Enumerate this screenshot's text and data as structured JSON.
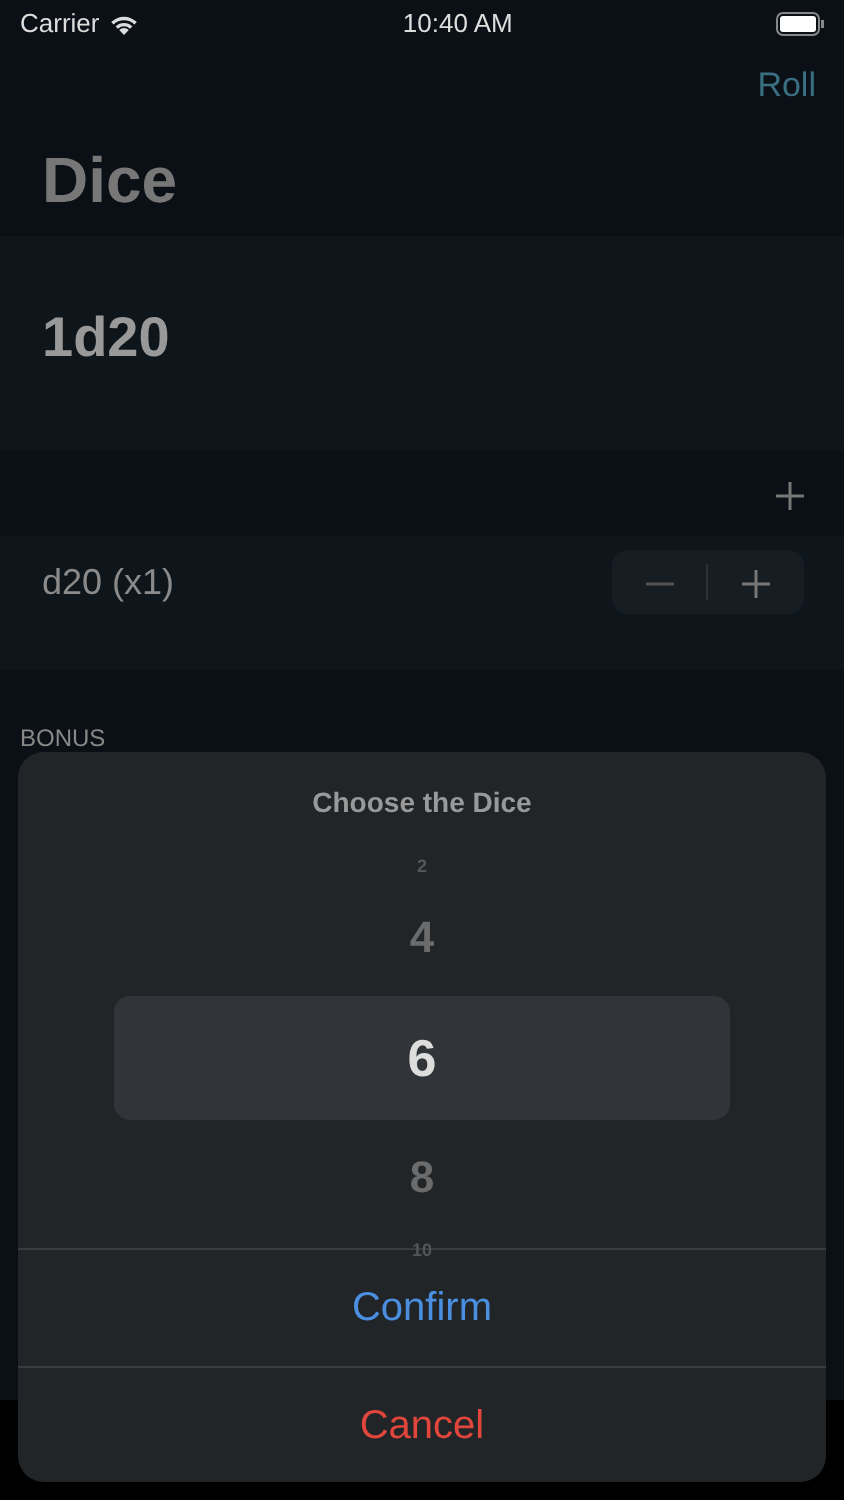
{
  "status_bar": {
    "carrier": "Carrier",
    "time": "10:40 AM"
  },
  "nav": {
    "action": "Roll",
    "title": "Dice"
  },
  "formula": "1d20",
  "dice": [
    {
      "label": "d20 (x1)"
    }
  ],
  "section_label": "BONUS",
  "sheet": {
    "title": "Choose the Dice",
    "picker": [
      {
        "label": "2",
        "selected": false,
        "kind": "edge"
      },
      {
        "label": "4",
        "selected": false,
        "kind": "near"
      },
      {
        "label": "6",
        "selected": true,
        "kind": "near"
      },
      {
        "label": "8",
        "selected": false,
        "kind": "near"
      },
      {
        "label": "10",
        "selected": false,
        "kind": "edge"
      }
    ],
    "actions": [
      {
        "label": "Confirm",
        "kind": "default"
      },
      {
        "label": "Cancel",
        "kind": "destructive"
      }
    ]
  }
}
